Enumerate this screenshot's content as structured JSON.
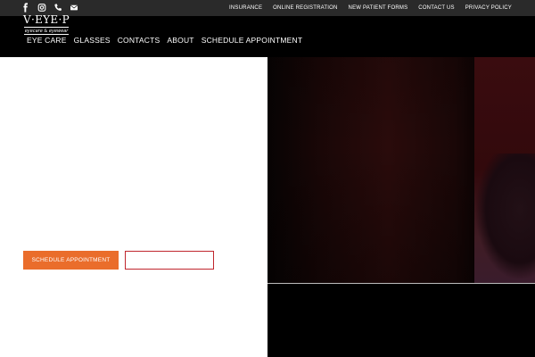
{
  "social": {
    "icons": [
      "facebook-icon",
      "instagram-icon",
      "phone-icon",
      "envelope-icon"
    ],
    "icon_color": "#ffffff"
  },
  "utility_nav": {
    "items": [
      "INSURANCE",
      "ONLINE REGISTRATION",
      "NEW PATIENT FORMS",
      "CONTACT US",
      "PRIVACY POLICY"
    ]
  },
  "logo": {
    "brand": "V·EYE·P",
    "tagline": "eyecare & eyewear"
  },
  "main_nav": {
    "items": [
      "EYE CARE",
      "GLASSES",
      "CONTACTS",
      "ABOUT",
      "SCHEDULE APPOINTMENT"
    ]
  },
  "hero": {
    "primary_button": "SCHEDULE APPOINTMENT",
    "secondary_button": ""
  },
  "colors": {
    "accent": "#ea6d2b",
    "outline": "#c0262d",
    "topbar": "#2a2a2a",
    "header": "#000000"
  }
}
